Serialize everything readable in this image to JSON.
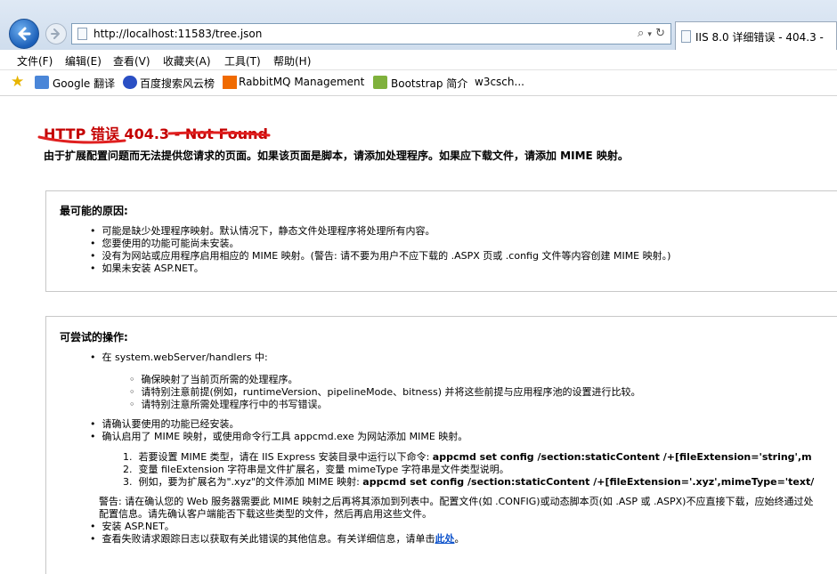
{
  "browser": {
    "url": "http://localhost:11583/tree.json",
    "address_tools": "ρ • ↻",
    "tab_title": "IIS 8.0 详细错误 - 404.3 -"
  },
  "menu": [
    "文件(F)",
    "编辑(E)",
    "查看(V)",
    "收藏夹(A)",
    "工具(T)",
    "帮助(H)"
  ],
  "favorites": [
    "Google 翻译",
    "百度搜索风云榜",
    "RabbitMQ Management",
    "Bootstrap 简介",
    "w3csch..."
  ],
  "page": {
    "title": "HTTP 错误 404.3 - Not Found",
    "intro": "由于扩展配置问题而无法提供您请求的页面。如果该页面是脚本，请添加处理程序。如果应下载文件，请添加 MIME 映射。",
    "causes_heading": "最可能的原因:",
    "causes": [
      "可能是缺少处理程序映射。默认情况下，静态文件处理程序将处理所有内容。",
      "您要使用的功能可能尚未安装。",
      "没有为网站或应用程序启用相应的 MIME 映射。(警告: 请不要为用户不应下载的 .ASPX 页或 .config 文件等内容创建 MIME 映射。)",
      "如果未安装 ASP.NET。"
    ],
    "actions_heading": "可尝试的操作:",
    "a1": "在 system.webServer/handlers 中:",
    "a1_sub": [
      "确保映射了当前页所需的处理程序。",
      "请特别注意前提(例如，runtimeVersion、pipelineMode、bitness) 并将这些前提与应用程序池的设置进行比较。",
      "请特别注意所需处理程序行中的书写错误。"
    ],
    "a2": "请确认要使用的功能已经安装。",
    "a3": "确认启用了 MIME 映射，或使用命令行工具 appcmd.exe 为网站添加 MIME 映射。",
    "steps": [
      {
        "num": "1.",
        "text": "若要设置 MIME 类型，请在 IIS Express 安装目录中运行以下命令: ",
        "bold": "appcmd set config /section:staticContent /+[fileExtension='string',m"
      },
      {
        "num": "2.",
        "text": "变量 fileExtension 字符串是文件扩展名，变量 mimeType 字符串是文件类型说明。",
        "bold": ""
      },
      {
        "num": "3.",
        "text": "例如，要为扩展名为\".xyz\"的文件添加 MIME 映射: ",
        "bold": "appcmd set config /section:staticContent /+[fileExtension='.xyz',mimeType='text/"
      }
    ],
    "warning_1": "警告: 请在确认您的 Web 服务器需要此 MIME 映射之后再将其添加到列表中。配置文件(如 .CONFIG)或动态脚本页(如 .ASP 或 .ASPX)不应直接下载，应始终通过处",
    "warning_2": "配置信息。请先确认客户端能否下载这些类型的文件，然后再启用这些文件。",
    "a4": "安装 ASP.NET。",
    "a5_pre": "查看失败请求跟踪日志以获取有关此错误的其他信息。有关详细信息，请单击",
    "a5_link": "此处",
    "a5_post": "。"
  },
  "colors": {
    "error_title": "#c40000",
    "scribble": "#e02020",
    "link": "#1155cc"
  }
}
